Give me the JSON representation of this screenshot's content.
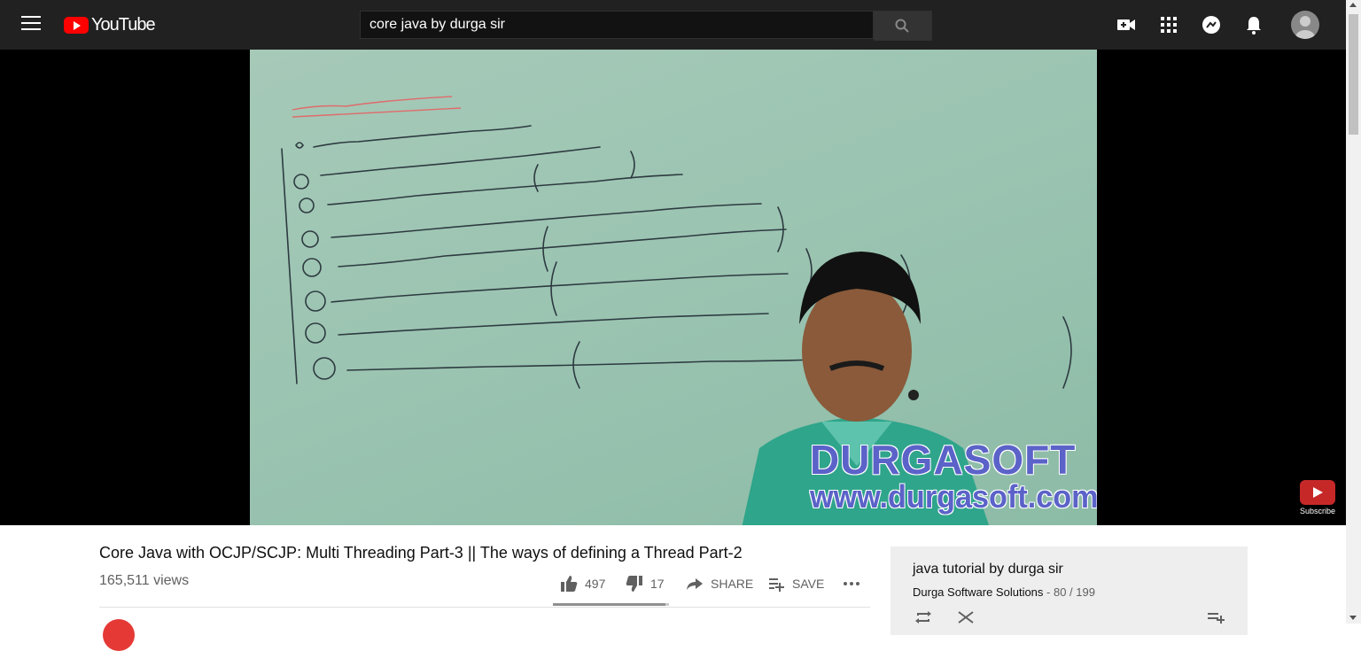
{
  "header": {
    "menu_icon": "hamburger-menu-icon",
    "logo_text": "YouTube",
    "search": {
      "value": "core java by durga sir",
      "placeholder": "Search"
    },
    "icons": [
      "video-camera-icon",
      "apps-grid-icon",
      "messages-icon",
      "notifications-bell-icon"
    ]
  },
  "player": {
    "watermark_brand": "DURGASOFT",
    "watermark_url": "www.durgasoft.com",
    "subscribe_label": "Subscribe"
  },
  "video": {
    "title": "Core Java with OCJP/SCJP: Multi Threading Part-3 || The ways of defining a Thread Part-2",
    "views": "165,511 views",
    "likes": "497",
    "dislikes": "17",
    "share_label": "SHARE",
    "save_label": "SAVE",
    "like_ratio": 0.967
  },
  "playlist": {
    "title": "java tutorial by durga sir",
    "owner": "Durga Software Solutions",
    "separator": " - ",
    "position": "80 / 199"
  },
  "colors": {
    "topbar": "#212121",
    "brand_red": "#ff0000",
    "watermark": "#5b62c8",
    "board": "#9ec6b3"
  }
}
